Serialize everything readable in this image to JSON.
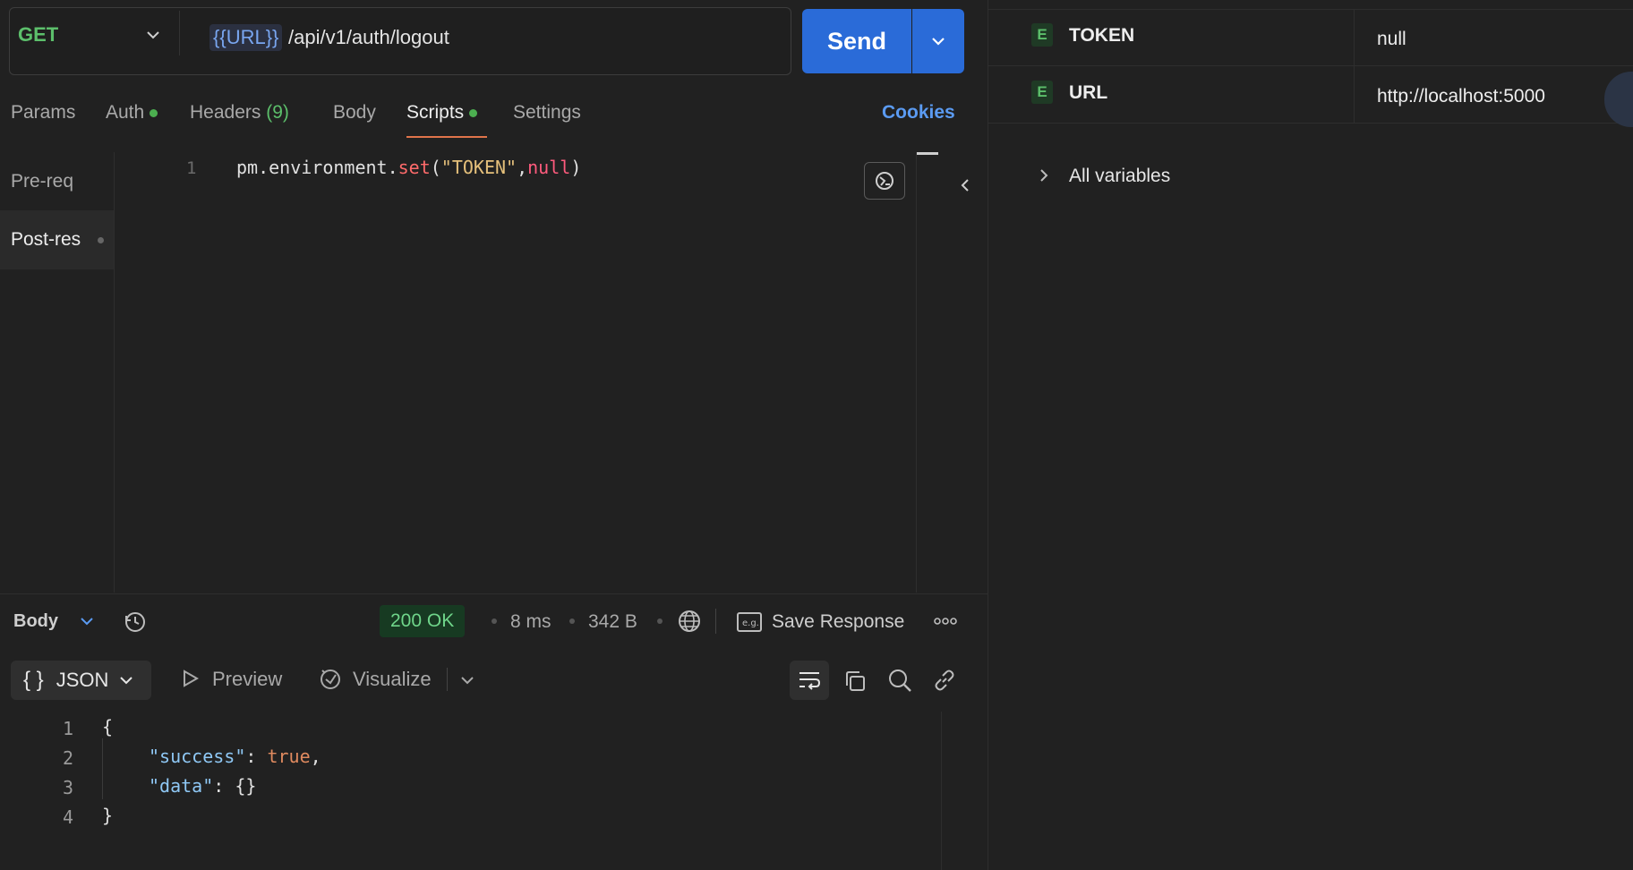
{
  "request": {
    "method": "GET",
    "url_variable": "{{URL}}",
    "url_path": "/api/v1/auth/logout",
    "send_label": "Send"
  },
  "tabs": [
    {
      "label": "Params"
    },
    {
      "label": "Auth"
    },
    {
      "label": "Headers",
      "count": "(9)"
    },
    {
      "label": "Body"
    },
    {
      "label": "Scripts"
    },
    {
      "label": "Settings"
    }
  ],
  "cookies_label": "Cookies",
  "scripts": {
    "pre_label": "Pre-req",
    "post_label": "Post-res",
    "line_number": "1",
    "code": {
      "obj": "pm.environment.",
      "fn": "set",
      "open": "(",
      "str": "\"TOKEN\"",
      "comma": ",",
      "null": "null",
      "close": ")"
    }
  },
  "response": {
    "body_label": "Body",
    "status": "200 OK",
    "time": "8 ms",
    "size": "342 B",
    "save_label": "Save Response",
    "format_label": "JSON",
    "format_braces": "{ }",
    "preview_label": "Preview",
    "visualize_label": "Visualize",
    "lines": [
      {
        "n": "1",
        "text": "{"
      },
      {
        "n": "2",
        "key": "\"success\"",
        "sep": ": ",
        "val": "true",
        "tail": ","
      },
      {
        "n": "3",
        "key": "\"data\"",
        "sep": ": ",
        "val": "{}"
      },
      {
        "n": "4",
        "text": "}"
      }
    ]
  },
  "environment": {
    "variables": [
      {
        "badge": "E",
        "name": "TOKEN",
        "value": "null"
      },
      {
        "badge": "E",
        "name": "URL",
        "value": "http://localhost:5000"
      }
    ],
    "all_variables_label": "All variables"
  },
  "colors": {
    "accent_blue": "#2a6bd8",
    "method_green": "#5cbf6b",
    "tab_underline": "#e0744a",
    "status_green": "#6fd58a"
  }
}
